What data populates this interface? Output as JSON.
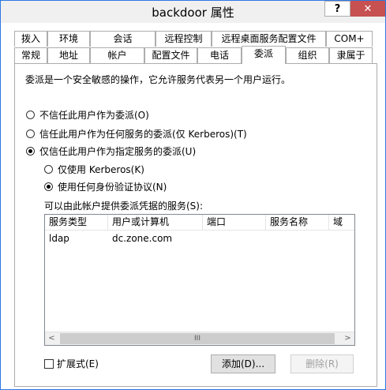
{
  "window": {
    "title": "backdoor 属性",
    "help_label": "?",
    "close_label": "✕"
  },
  "tabs": {
    "row1": [
      "拨入",
      "环境",
      "会话",
      "远程控制",
      "远程桌面服务配置文件",
      "COM+"
    ],
    "row2": [
      "常规",
      "地址",
      "帐户",
      "配置文件",
      "电话",
      "委派",
      "组织",
      "隶属于"
    ],
    "active": "委派"
  },
  "delegation": {
    "description": "委派是一个安全敏感的操作，它允许服务代表另一个用户运行。",
    "options": [
      {
        "label": "不信任此用户作为委派(O)",
        "selected": false
      },
      {
        "label": "信任此用户作为任何服务的委派(仅 Kerberos)(T)",
        "selected": false
      },
      {
        "label": "仅信任此用户作为指定服务的委派(U)",
        "selected": true
      }
    ],
    "sub_options": [
      {
        "label": "仅使用 Kerberos(K)",
        "selected": false
      },
      {
        "label": "使用任何身份验证协议(N)",
        "selected": true
      }
    ],
    "services_label": "可以由此帐户提供委派凭据的服务(S):",
    "columns": [
      "服务类型",
      "用户或计算机",
      "端口",
      "服务名称",
      "域"
    ],
    "rows": [
      {
        "service_type": "ldap",
        "user_or_computer": "dc.zone.com",
        "port": "",
        "service_name": "",
        "domain": ""
      }
    ],
    "scroll_left": "<",
    "scroll_right": ">",
    "scroll_thumb": "III",
    "expanded_label": "扩展式(E)",
    "expanded_checked": false,
    "add_label": "添加(D)...",
    "remove_label": "删除(R)"
  }
}
